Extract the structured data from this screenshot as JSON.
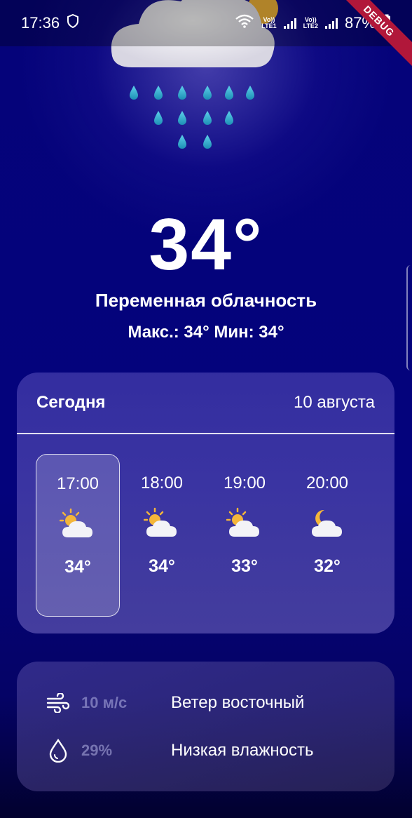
{
  "status_bar": {
    "time": "17:36",
    "sim1": "LTE1",
    "sim2": "LTE2",
    "volte": "Vo))",
    "battery": "87%"
  },
  "debug_banner": "DEBUG",
  "current": {
    "temperature": "34°",
    "condition": "Переменная облачность",
    "max_min": "Макс.: 34° Мин: 34°",
    "hero_icon": "rain-cloud-sun-icon"
  },
  "today": {
    "title": "Сегодня",
    "date": "10 августа",
    "hours": [
      {
        "time": "17:00",
        "temp": "34°",
        "icon": "partly-cloudy-day-icon"
      },
      {
        "time": "18:00",
        "temp": "34°",
        "icon": "partly-cloudy-day-icon"
      },
      {
        "time": "19:00",
        "temp": "33°",
        "icon": "partly-cloudy-day-icon"
      },
      {
        "time": "20:00",
        "temp": "32°",
        "icon": "partly-cloudy-night-icon"
      }
    ]
  },
  "details": {
    "wind_value": "10 м/с",
    "wind_label": "Ветер восточный",
    "humidity_value": "29%",
    "humidity_label": "Низкая влажность"
  },
  "colors": {
    "background": "#04037c",
    "card": "#3b3392",
    "sun": "#f4b63a",
    "raindrop": "#2ab3d1",
    "debug": "#b1173a"
  }
}
